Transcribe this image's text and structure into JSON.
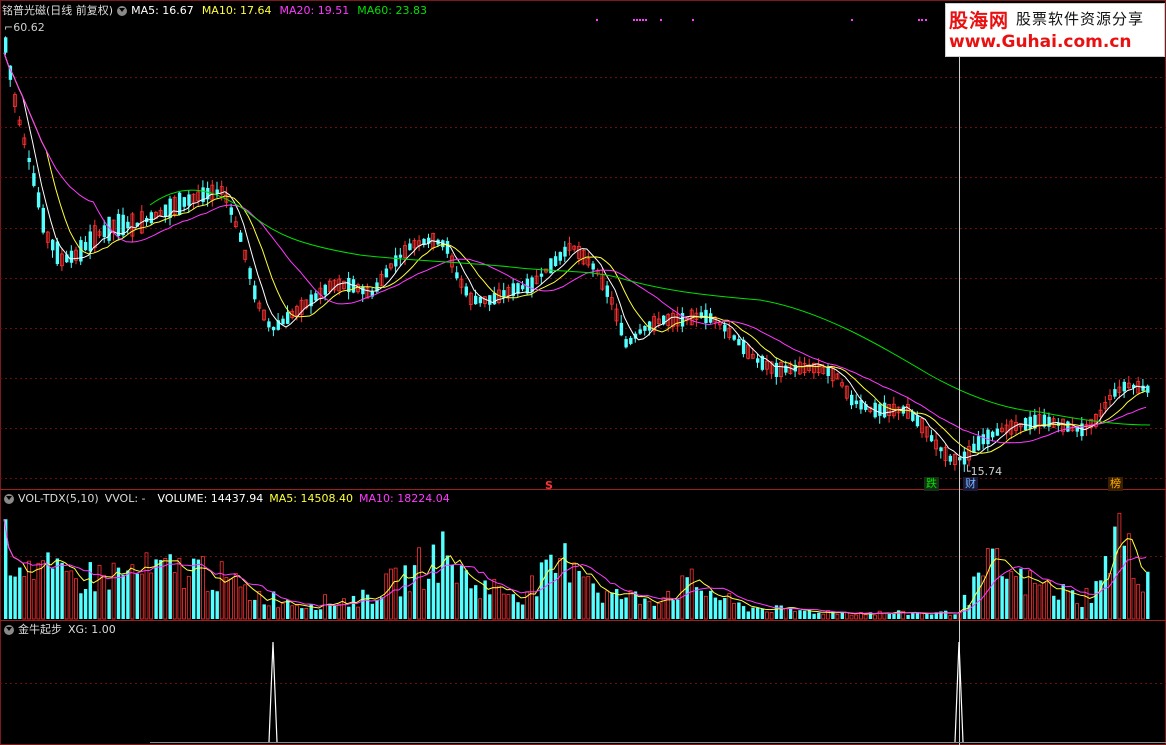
{
  "stock": {
    "name": "铭普光磁(日线 前复权)"
  },
  "main_legend": {
    "ma5": "MA5: 16.67",
    "ma10": "MA10: 17.64",
    "ma20": "MA20: 19.51",
    "ma60": "MA60: 23.83"
  },
  "price_high_label": "60.62",
  "price_low_label": "15.74",
  "markers": {
    "s": "S",
    "die": "跌",
    "cai": "财",
    "bang": "榜"
  },
  "vol_legend": {
    "name": "VOL-TDX(5,10)",
    "vvol": "VVOL: -",
    "volume": "VOLUME: 14437.94",
    "ma5": "MA5: 14508.40",
    "ma10": "MA10: 18224.04"
  },
  "xg_legend": {
    "name": "金牛起步",
    "xg": "XG: 1.00"
  },
  "logo": {
    "line1": "股海网",
    "line2": "股票软件资源分享",
    "line3": "www.Guhai.com.cn"
  },
  "colors": {
    "up": "#ff3232",
    "down": "#54ffff",
    "ma5": "#ffffff",
    "ma10": "#ffff3a",
    "ma20": "#ff3aff",
    "ma60": "#00e000",
    "grid": "#7a1a1a"
  },
  "chart_data": {
    "type": "candlestick",
    "price_range": [
      15.74,
      60.62
    ],
    "volume_ma10_last": 18224.04,
    "xg_signals": [
      1.0,
      1.0
    ]
  }
}
